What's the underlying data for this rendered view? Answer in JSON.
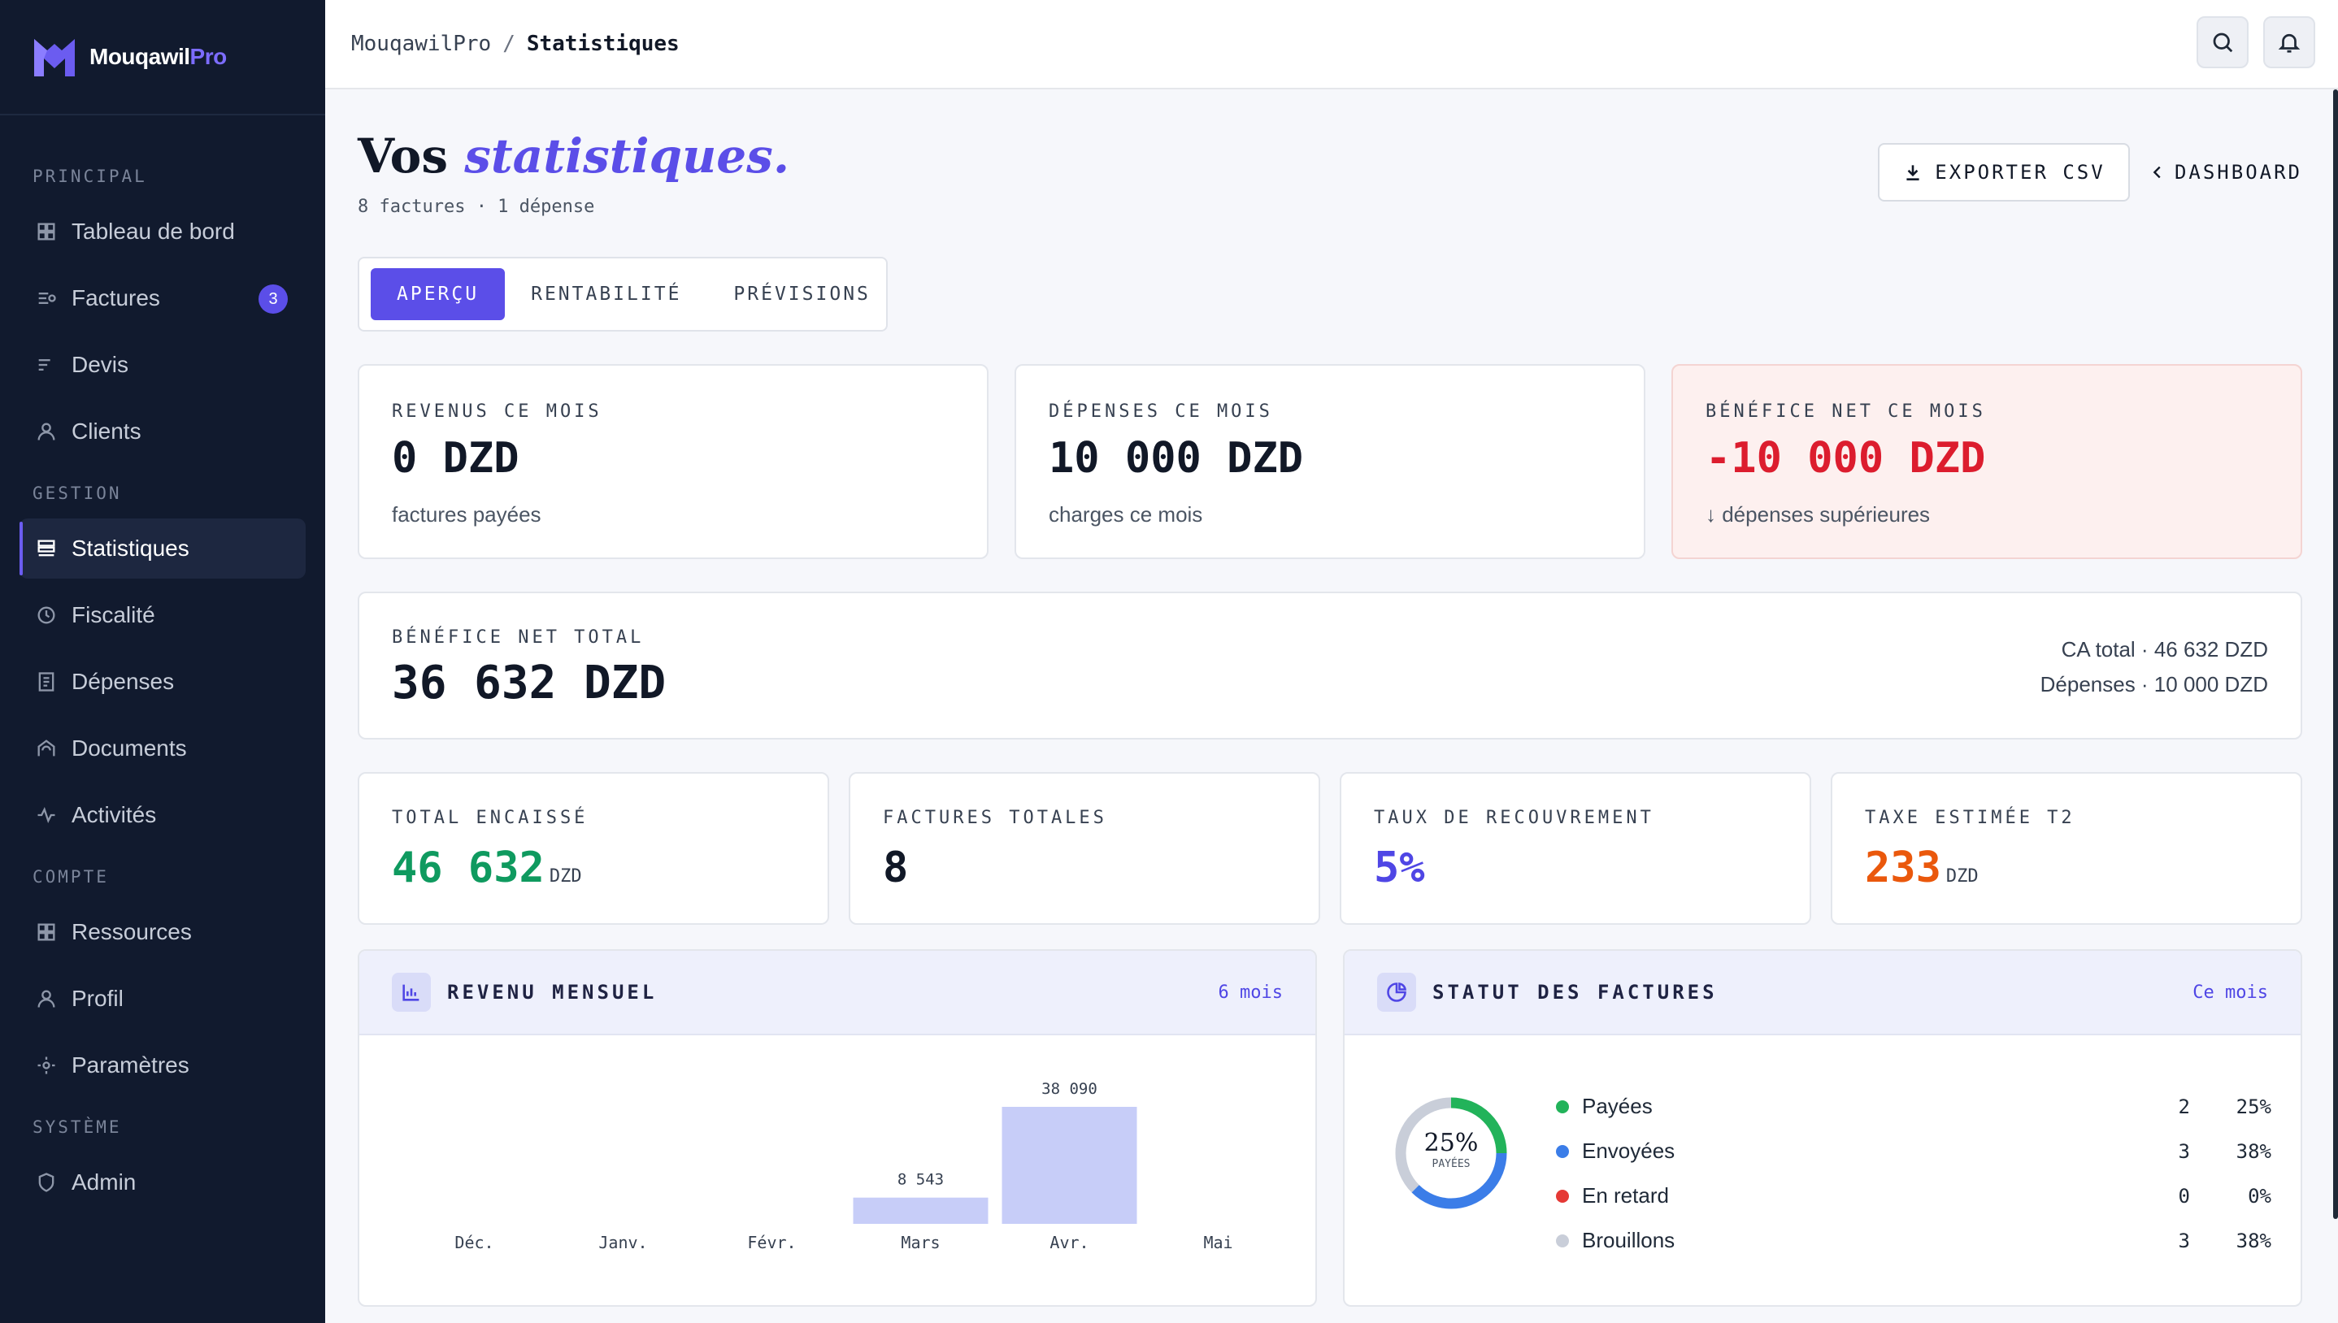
{
  "brand": {
    "name_main": "Mouqawil",
    "name_accent": "Pro"
  },
  "sidebar": {
    "sections": [
      {
        "title": "PRINCIPAL",
        "items": [
          {
            "label": "Tableau de bord",
            "icon": "grid-icon"
          },
          {
            "label": "Factures",
            "icon": "invoice-icon",
            "badge": "3"
          },
          {
            "label": "Devis",
            "icon": "lines-icon"
          },
          {
            "label": "Clients",
            "icon": "user-icon"
          }
        ]
      },
      {
        "title": "GESTION",
        "items": [
          {
            "label": "Statistiques",
            "icon": "stats-icon",
            "active": true
          },
          {
            "label": "Fiscalité",
            "icon": "clock-icon"
          },
          {
            "label": "Dépenses",
            "icon": "receipt-icon"
          },
          {
            "label": "Documents",
            "icon": "archive-icon"
          },
          {
            "label": "Activités",
            "icon": "pulse-icon"
          }
        ]
      },
      {
        "title": "COMPTE",
        "items": [
          {
            "label": "Ressources",
            "icon": "grid-icon"
          },
          {
            "label": "Profil",
            "icon": "user-icon"
          },
          {
            "label": "Paramètres",
            "icon": "gear-icon"
          }
        ]
      },
      {
        "title": "SYSTÈME",
        "items": [
          {
            "label": "Admin",
            "icon": "shield-icon"
          }
        ]
      }
    ]
  },
  "topbar": {
    "crumb_root": "MouqawilPro",
    "crumb_sep": "/",
    "crumb_current": "Statistiques"
  },
  "header": {
    "title_plain": "Vos",
    "title_accent": "statistiques.",
    "subtitle": "8 factures · 1 dépense",
    "export_label": "EXPORTER CSV",
    "dashboard_label": "DASHBOARD"
  },
  "tabs": [
    "APERÇU",
    "RENTABILITÉ",
    "PRÉVISIONS"
  ],
  "kpis": [
    {
      "label": "REVENUS CE MOIS",
      "value": "0 DZD",
      "note": "factures payées"
    },
    {
      "label": "DÉPENSES CE MOIS",
      "value": "10 000 DZD",
      "note": "charges ce mois"
    },
    {
      "label": "BÉNÉFICE NET CE MOIS",
      "value": "-10 000 DZD",
      "note": "↓ dépenses supérieures"
    }
  ],
  "total": {
    "label": "BÉNÉFICE NET TOTAL",
    "value": "36 632 DZD",
    "ca": "CA total · 46 632 DZD",
    "depenses": "Dépenses · 10 000 DZD"
  },
  "mini": [
    {
      "label": "TOTAL ENCAISSÉ",
      "value": "46 632",
      "unit": "DZD",
      "color": "#0f9a5f"
    },
    {
      "label": "FACTURES TOTALES",
      "value": "8",
      "unit": "",
      "color": "#111827"
    },
    {
      "label": "TAUX DE RECOUVREMENT",
      "value": "5%",
      "unit": "",
      "color": "#4f46e5"
    },
    {
      "label": "TAXE ESTIMÉE T2",
      "value": "233",
      "unit": "DZD",
      "color": "#ea580c"
    }
  ],
  "revenue_panel": {
    "title": "REVENU MENSUEL",
    "meta": "6 mois"
  },
  "status_panel": {
    "title": "STATUT DES FACTURES",
    "meta": "Ce mois"
  },
  "chart_data": {
    "type": "bar",
    "categories": [
      "Déc.",
      "Janv.",
      "Févr.",
      "Mars",
      "Avr.",
      "Mai"
    ],
    "values": [
      0,
      0,
      0,
      8543,
      38090,
      0
    ],
    "data_labels": [
      "",
      "",
      "",
      "8 543",
      "38 090",
      ""
    ],
    "color": "#c7cdf8"
  },
  "invoice_status": {
    "center_value": "25%",
    "center_label": "PAYÉES",
    "items": [
      {
        "label": "Payées",
        "count": "2",
        "pct": "25%",
        "share": 25,
        "color": "#22b35a"
      },
      {
        "label": "Envoyées",
        "count": "3",
        "pct": "38%",
        "share": 37.5,
        "color": "#3b7de8"
      },
      {
        "label": "En retard",
        "count": "0",
        "pct": "0%",
        "share": 0,
        "color": "#e53935"
      },
      {
        "label": "Brouillons",
        "count": "3",
        "pct": "38%",
        "share": 37.5,
        "color": "#c9ced9"
      }
    ]
  }
}
